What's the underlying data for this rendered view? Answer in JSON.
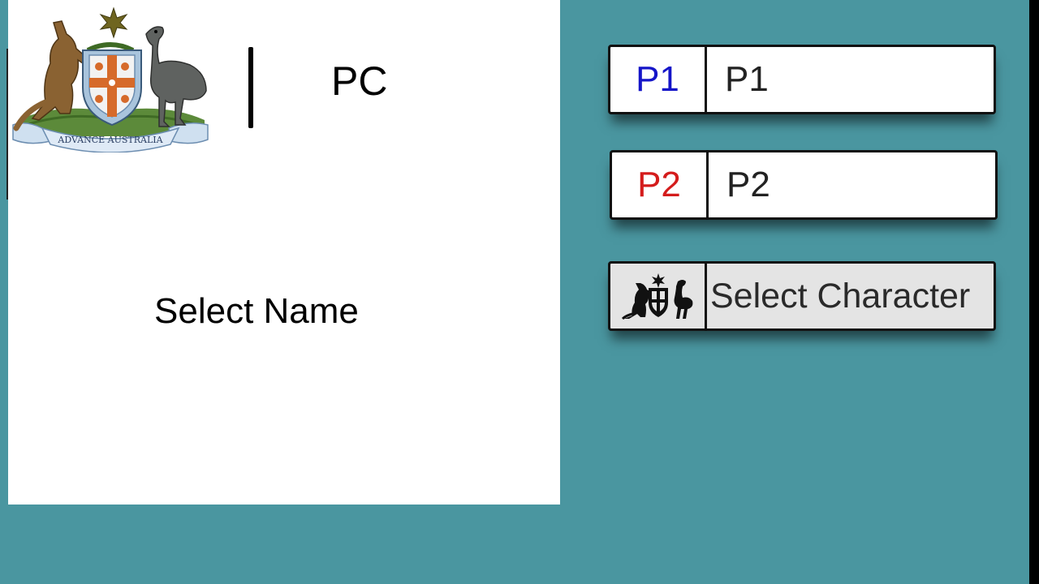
{
  "colors": {
    "background": "#4a96a0",
    "panel": "#ffffff",
    "p1_color": "#1515c8",
    "p2_color": "#d41c1c"
  },
  "left_panel": {
    "emblem_icon": "australian-coat-of-arms-icon",
    "emblem_motto": "ADVANCE AUSTRALIA",
    "mode_label": "PC",
    "prompt": "Select Name"
  },
  "players": [
    {
      "tag": "P1",
      "name": "P1"
    },
    {
      "tag": "P2",
      "name": "P2"
    }
  ],
  "character": {
    "icon": "coat-of-arms-silhouette-icon",
    "label": "Select Character"
  }
}
